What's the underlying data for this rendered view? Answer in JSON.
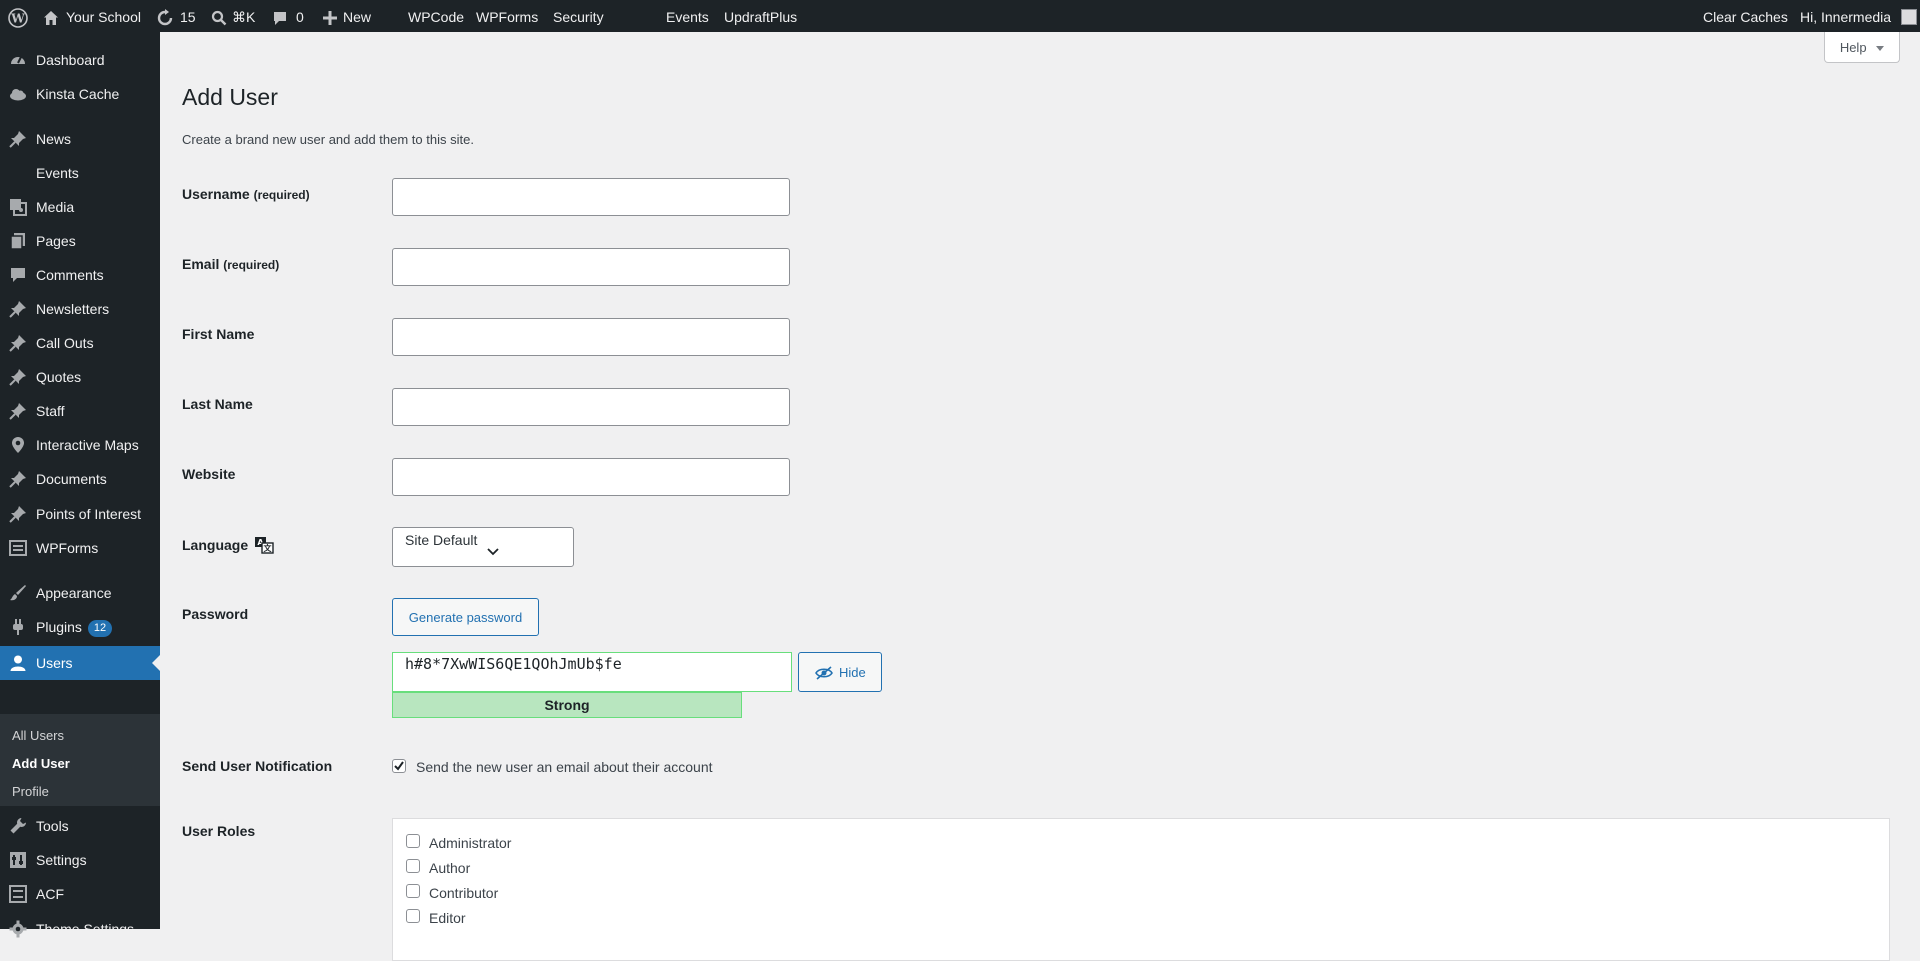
{
  "adminbar": {
    "site_name": "Your School",
    "updates_count": "15",
    "search_shortcut": "⌘K",
    "comments_count": "0",
    "new_label": "New",
    "menu_items": [
      "WPCode",
      "WPForms",
      "Security",
      "Events",
      "UpdraftPlus"
    ],
    "clear_caches": "Clear Caches",
    "greeting": "Hi, Innermedia"
  },
  "help_label": "Help",
  "sidebar": {
    "items": [
      {
        "label": "Dashboard",
        "icon": "dashboard-icon"
      },
      {
        "label": "Kinsta Cache",
        "icon": "cloud-icon"
      },
      {
        "label": "News",
        "icon": "pin-icon"
      },
      {
        "label": "Events",
        "icon": "none"
      },
      {
        "label": "Media",
        "icon": "media-icon"
      },
      {
        "label": "Pages",
        "icon": "pages-icon"
      },
      {
        "label": "Comments",
        "icon": "comment-icon"
      },
      {
        "label": "Newsletters",
        "icon": "pin-icon"
      },
      {
        "label": "Call Outs",
        "icon": "pin-icon"
      },
      {
        "label": "Quotes",
        "icon": "pin-icon"
      },
      {
        "label": "Staff",
        "icon": "pin-icon"
      },
      {
        "label": "Interactive Maps",
        "icon": "location-icon"
      },
      {
        "label": "Documents",
        "icon": "pin-icon"
      },
      {
        "label": "Points of Interest",
        "icon": "pin-icon"
      },
      {
        "label": "WPForms",
        "icon": "forms-icon"
      },
      {
        "label": "Appearance",
        "icon": "brush-icon"
      },
      {
        "label": "Plugins",
        "icon": "plugin-icon",
        "badge": "12"
      },
      {
        "label": "Users",
        "icon": "user-icon"
      },
      {
        "label": "Tools",
        "icon": "wrench-icon"
      },
      {
        "label": "Settings",
        "icon": "settings-icon"
      },
      {
        "label": "ACF",
        "icon": "acf-icon"
      },
      {
        "label": "Theme Settings",
        "icon": "gear-icon"
      }
    ],
    "submenu": [
      "All Users",
      "Add User",
      "Profile"
    ]
  },
  "page": {
    "title": "Add User",
    "intro": "Create a brand new user and add them to this site."
  },
  "form": {
    "username_label": "Username",
    "username_req": "(required)",
    "email_label": "Email",
    "email_req": "(required)",
    "firstname_label": "First Name",
    "lastname_label": "Last Name",
    "website_label": "Website",
    "language_label": "Language",
    "language_value": "Site Default",
    "password_label": "Password",
    "generate_label": "Generate password",
    "password_value": "h#8*7XwWIS6QE1QOhJmUb$fe",
    "strength_label": "Strong",
    "hide_label": "Hide",
    "notification_label": "Send User Notification",
    "notification_text": "Send the new user an email about their account",
    "notification_checked": true,
    "roles_label": "User Roles",
    "roles": [
      "Administrator",
      "Author",
      "Contributor",
      "Editor"
    ]
  }
}
